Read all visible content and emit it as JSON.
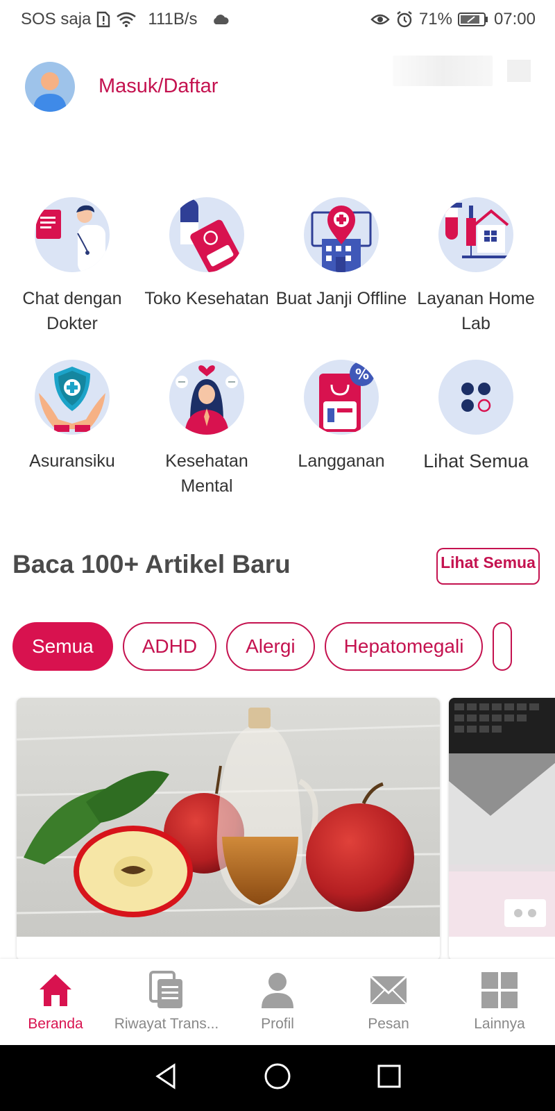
{
  "status_bar": {
    "carrier": "SOS saja",
    "speed": "111B/s",
    "battery": "71%",
    "time": "07:00",
    "icons": [
      "sim-alert-icon",
      "wifi-icon",
      "cloud-icon",
      "eye-icon",
      "alarm-icon",
      "battery-icon"
    ]
  },
  "header": {
    "login_label": "Masuk/Daftar"
  },
  "services": [
    {
      "label": "Chat dengan Dokter",
      "icon": "doctor-chat-icon"
    },
    {
      "label": "Toko Kesehatan",
      "icon": "health-store-icon"
    },
    {
      "label": "Buat Janji Offline",
      "icon": "hospital-appointment-icon"
    },
    {
      "label": "Layanan Home Lab",
      "icon": "home-lab-icon"
    },
    {
      "label": "Asuransiku",
      "icon": "insurance-shield-icon"
    },
    {
      "label": "Kesehatan Mental",
      "icon": "mental-health-icon"
    },
    {
      "label": "Langganan",
      "icon": "subscription-icon"
    },
    {
      "label": "Lihat Semua",
      "icon": "see-all-dots-icon"
    }
  ],
  "articles": {
    "title": "Baca 100+ Artikel Baru",
    "see_all_label": "Lihat Semua",
    "chips": [
      "Semua",
      "ADHD",
      "Alergi",
      "Hepatomegali",
      ""
    ],
    "active_chip": "Semua"
  },
  "bottom_nav": [
    {
      "label": "Beranda",
      "icon": "home-icon",
      "active": true
    },
    {
      "label": "Riwayat Trans...",
      "icon": "history-icon",
      "active": false
    },
    {
      "label": "Profil",
      "icon": "profile-icon",
      "active": false
    },
    {
      "label": "Pesan",
      "icon": "mail-icon",
      "active": false
    },
    {
      "label": "Lainnya",
      "icon": "grid-icon",
      "active": false
    }
  ],
  "colors": {
    "accent": "#d8124f",
    "icon_bg": "#dbe4f5",
    "inactive": "#a0a0a0"
  }
}
